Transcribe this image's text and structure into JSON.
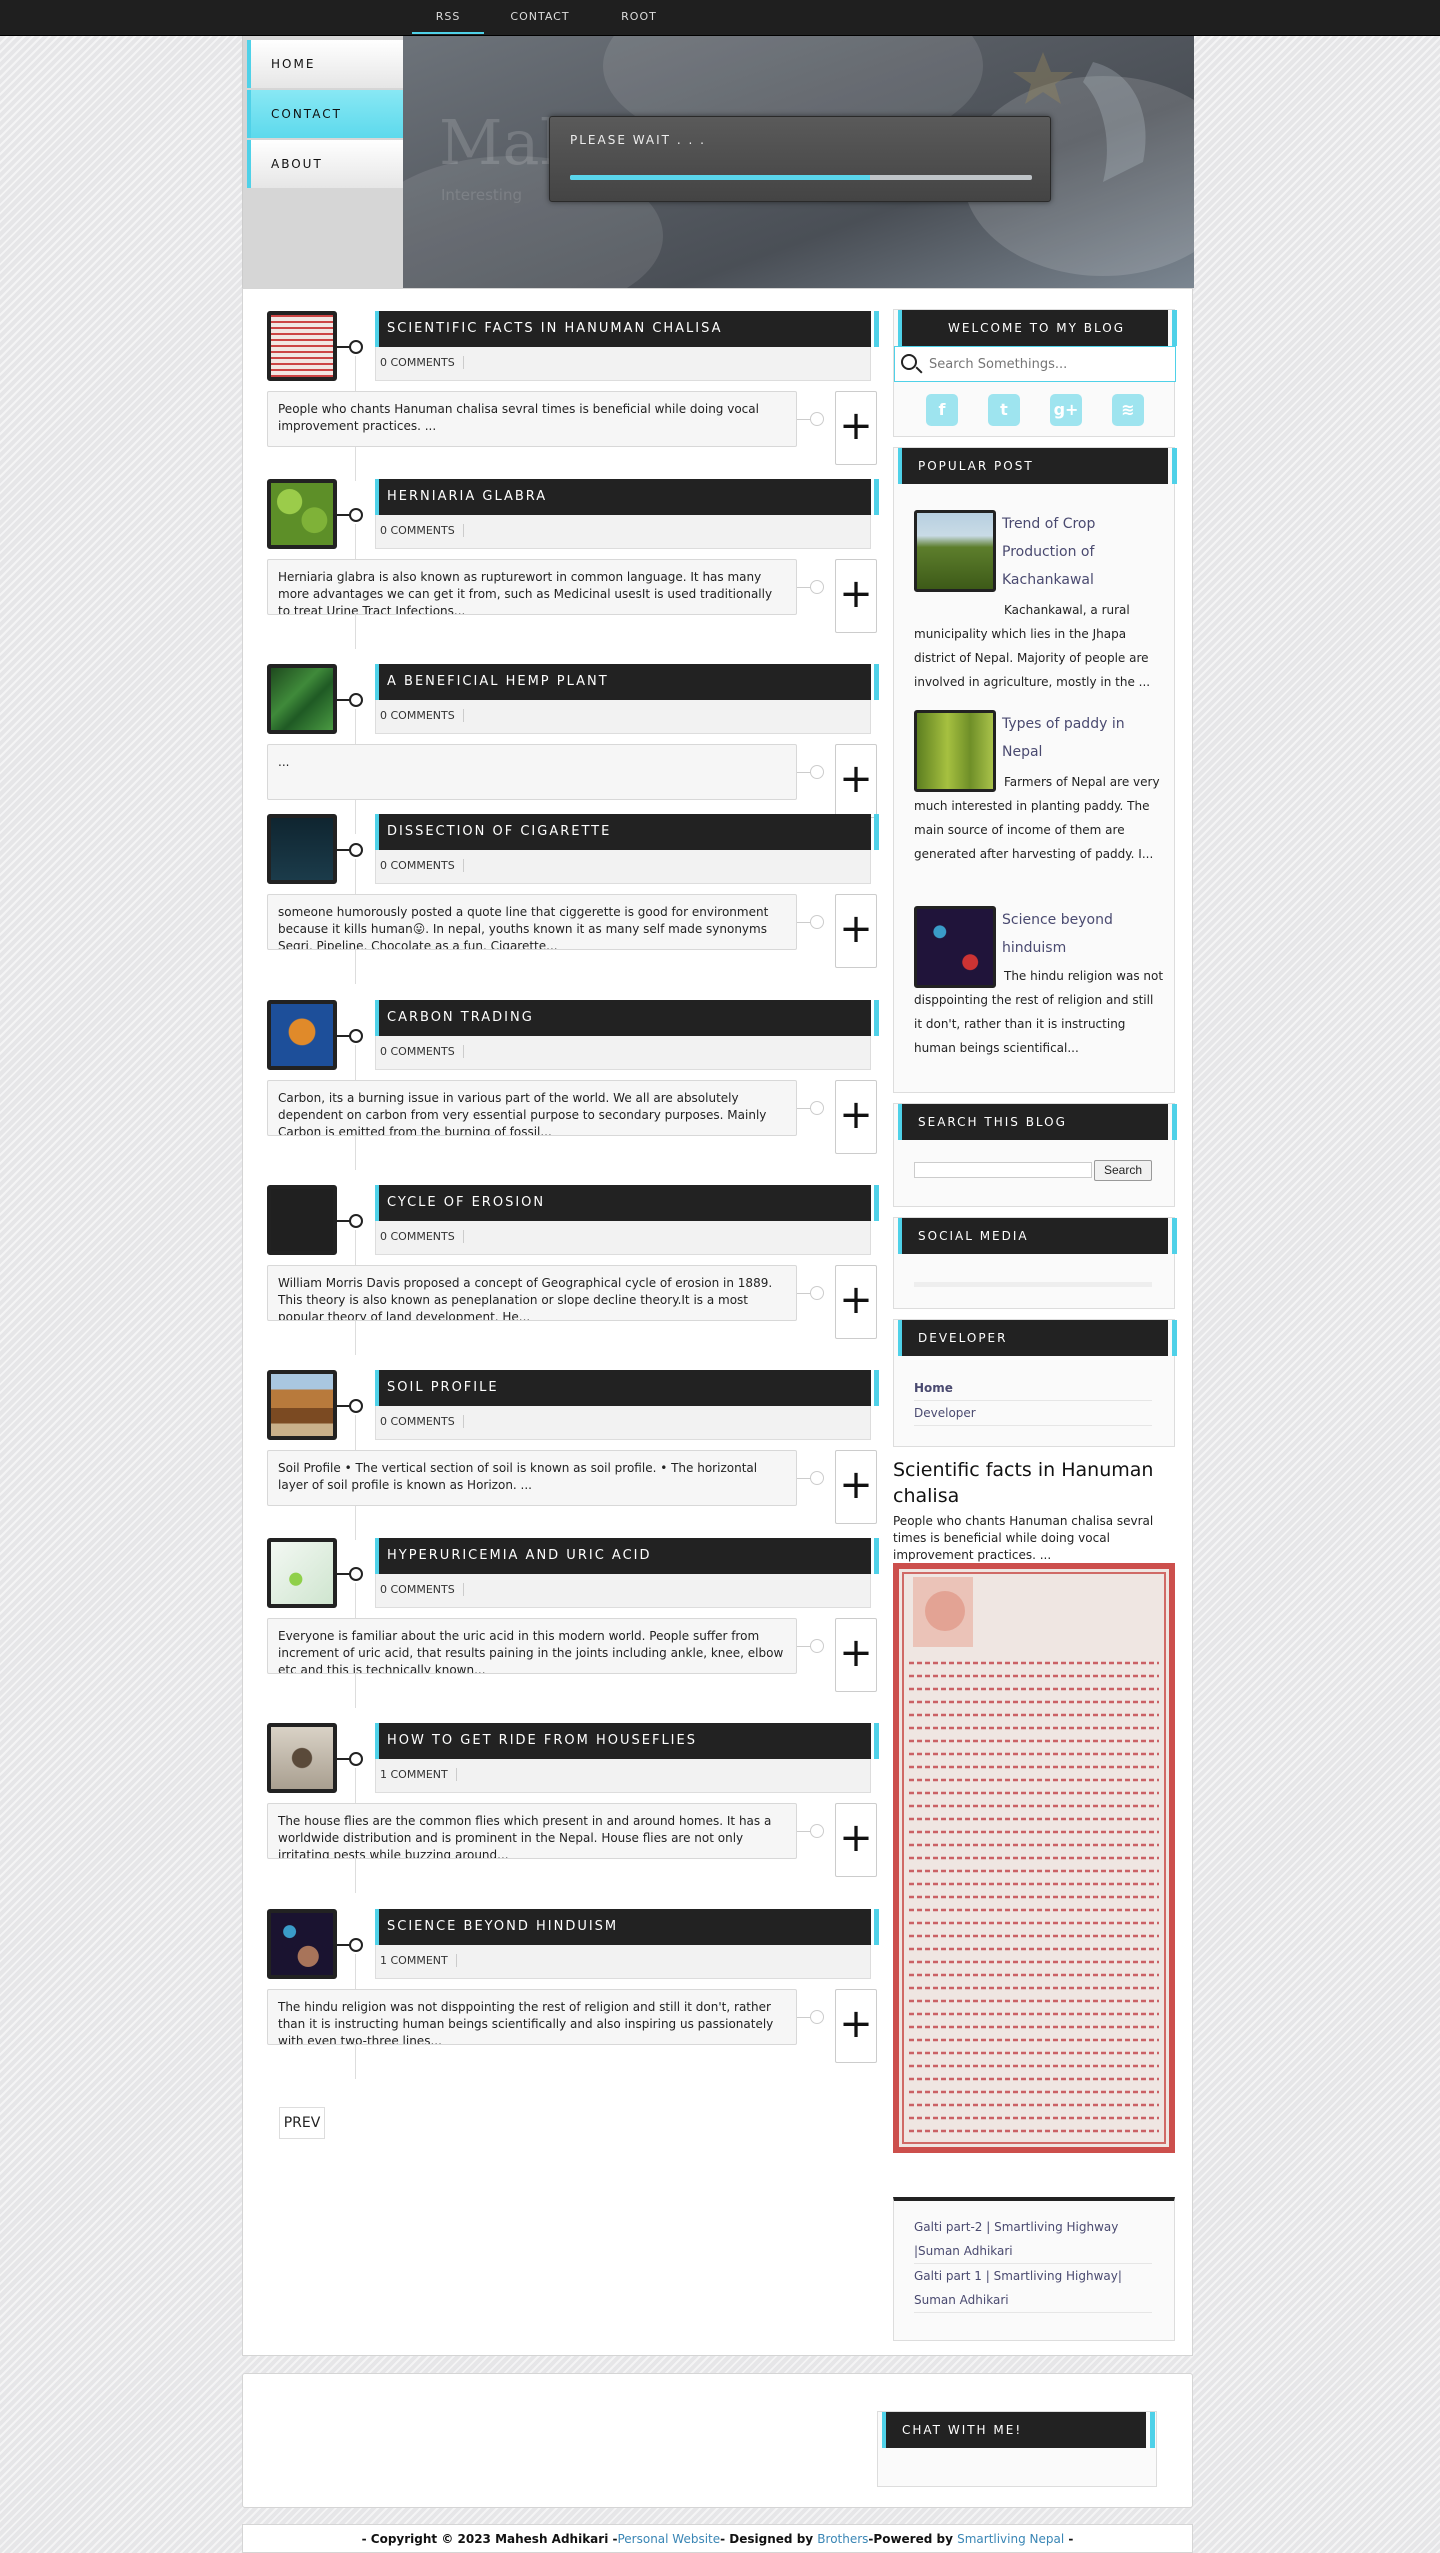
{
  "topnav": [
    "RSS",
    "CONTACT",
    "ROOT"
  ],
  "header": {
    "nav": [
      "HOME",
      "CONTACT",
      "ABOUT"
    ],
    "banner_title": "Mah",
    "banner_sub": "Interesting",
    "loader_text": "PLEASE WAIT . . .",
    "loader_progress": 0.65
  },
  "posts": [
    {
      "title": "SCIENTIFIC FACTS IN HANUMAN CHALISA",
      "comments": "0 COMMENTS",
      "excerpt": " People who chants Hanuman chalisa sevral times is beneficial while doing vocal improvement practices.                    ...",
      "thumb": "document"
    },
    {
      "title": "HERNIARIA GLABRA",
      "comments": "0 COMMENTS",
      "excerpt": " Herniaria glabra is also known as rupturewort in common language. It has many more advantages we can get it from, such as Medicinal usesIt is used traditionally to treat Urine Tract Infections...",
      "thumb": "green"
    },
    {
      "title": "A BENEFICIAL HEMP PLANT",
      "comments": "0 COMMENTS",
      "excerpt": "                             ...",
      "thumb": "leaves"
    },
    {
      "title": "DISSECTION OF CIGARETTE",
      "comments": "0 COMMENTS",
      "excerpt": "someone humorously posted a quote line that ciggerette is good for environment because it kills human😛. In nepal, youths known it as many self made synonyms Segri, Pipeline, Chocolate as a fun. Cigarette...",
      "thumb": "dark"
    },
    {
      "title": "CARBON TRADING",
      "comments": "0 COMMENTS",
      "excerpt": "Carbon, its a burning issue in various part of the world. We all are absolutely dependent on carbon from very essential purpose to secondary purposes. Mainly Carbon is emitted from the burning of fossil...",
      "thumb": "blue"
    },
    {
      "title": "CYCLE OF EROSION",
      "comments": "0 COMMENTS",
      "excerpt": "William Morris Davis proposed a concept of Geographical cycle of erosion in 1889. This theory is also known as peneplanation or slope decline theory.It is a most popular theory of land development. He...",
      "thumb": "black"
    },
    {
      "title": "SOIL PROFILE",
      "comments": "0 COMMENTS",
      "excerpt": "      Soil Profile      • The vertical section of soil is known as soil profile.      • The horizontal layer of soil profile is  known as Horizon. ...",
      "thumb": "soil"
    },
    {
      "title": "HYPERURICEMIA AND URIC ACID",
      "comments": "0 COMMENTS",
      "excerpt": "Everyone is familiar about the uric acid in this modern world. People suffer from increment of uric acid, that results paining in the joints including ankle, knee, elbow etc and this is technically known...",
      "thumb": "lab"
    },
    {
      "title": "HOW TO GET RIDE FROM HOUSEFLIES",
      "comments": "1 COMMENT",
      "excerpt": "The house flies are the common flies which  present in and around homes. It has a worldwide distribution and is prominent in the Nepal. House flies are not only irritating pests while buzzing around...",
      "thumb": "fly"
    },
    {
      "title": "SCIENCE BEYOND HINDUISM",
      "comments": "1 COMMENT",
      "excerpt": "The hindu religion was not disppointing the rest of religion and still it don't, rather than it is instructing human beings scientifically and also inspiring us passionately with even two-three lines...",
      "thumb": "space"
    }
  ],
  "prev_label": "PREV",
  "sidebar": {
    "welcome": "WELCOME TO MY BLOG",
    "search_placeholder": "Search Somethings...",
    "social_icons": [
      "facebook-icon",
      "twitter-icon",
      "google-plus-icon",
      "rss-icon"
    ],
    "popular_title": "POPULAR POST",
    "popular": [
      {
        "title": "Trend of Crop Production of Kachankawal",
        "excerpt": "Kachankawal, a rural municipality which lies in the Jhapa district of Nepal. Majority of people are involved in agriculture, mostly in the ..."
      },
      {
        "title": "Types of paddy in Nepal",
        "excerpt": " Farmers of Nepal are very much interested in planting paddy. The main source of income of them are generated after harvesting of paddy.  I..."
      },
      {
        "title": "Science beyond hinduism",
        "excerpt": "The hindu religion was not disppointing the rest of religion and still it don't, rather than it is instructing human beings scientifical..."
      }
    ],
    "search_blog_title": "SEARCH THIS BLOG",
    "search_button": "Search",
    "social_media_title": "SOCIAL MEDIA",
    "developer_title": "DEVELOPER",
    "developer_links": [
      "Home",
      "Developer"
    ],
    "featured_title": "Scientific facts in Hanuman chalisa",
    "featured_excerpt": "  People who chants Hanuman chalisa sevral times is beneficial while doing vocal improvement practices.                    ...",
    "video_links": [
      "Galti part-2 | Smartliving Highway |Suman Adhikari",
      "Galti part 1 | Smartliving Highway| Suman Adhikari"
    ]
  },
  "footer": {
    "chat_title": "CHAT WITH ME!",
    "copy_pre": "- Copyright © 2023 Mahesh Adhikari -",
    "link1": "Personal Website",
    "copy_mid": "- Designed by ",
    "link2": "Brothers",
    "copy_mid2": "-Powered by ",
    "link3": "Smartliving Nepal",
    "copy_end": " -"
  },
  "colors": {
    "accent": "#4fd1e8",
    "dark": "#222222",
    "link": "#4a4a70"
  }
}
